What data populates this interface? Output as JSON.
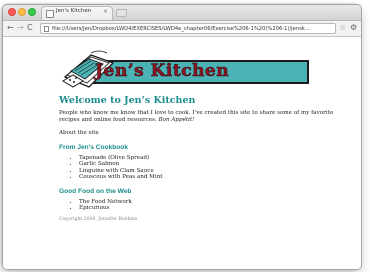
{
  "browser": {
    "tab_title": "Jen's Kitchen",
    "tab_close": "×",
    "url": "file:///Users/Jen/Dropbox/LWD4/EXERCISES/LWD4e_chapter06/Exercise%206-1%20(%206-1)/jensk...",
    "nav_back": "←",
    "nav_forward": "→",
    "nav_reload": "C",
    "star": "☆",
    "wrench": "⚙"
  },
  "page": {
    "banner_title": "Jen’s Kitchen",
    "heading": "Welcome to Jen’s Kitchen",
    "intro_text": "People who know me know that I love to cook. I’ve created this site to share some of my favorite recipes and online food resources. ",
    "intro_emphasis": "Bon Appétit!",
    "about_link": "About the site",
    "cookbook": {
      "heading": "From Jen’s Cookbook",
      "items": [
        "Tapenade (Olive Spread)",
        "Garlic Salmon",
        "Linguine with Clam Sauce",
        "Couscous with Peas and Mint"
      ]
    },
    "web": {
      "heading": "Good Food on the Web",
      "items": [
        "The Food Network",
        "Epicurious"
      ]
    },
    "copyright": "Copyright 2006, Jennifer Robbins"
  },
  "colors": {
    "accent": "#1b8d8e",
    "banner_bg": "#4bb3b5",
    "banner_text": "#8b1624"
  }
}
